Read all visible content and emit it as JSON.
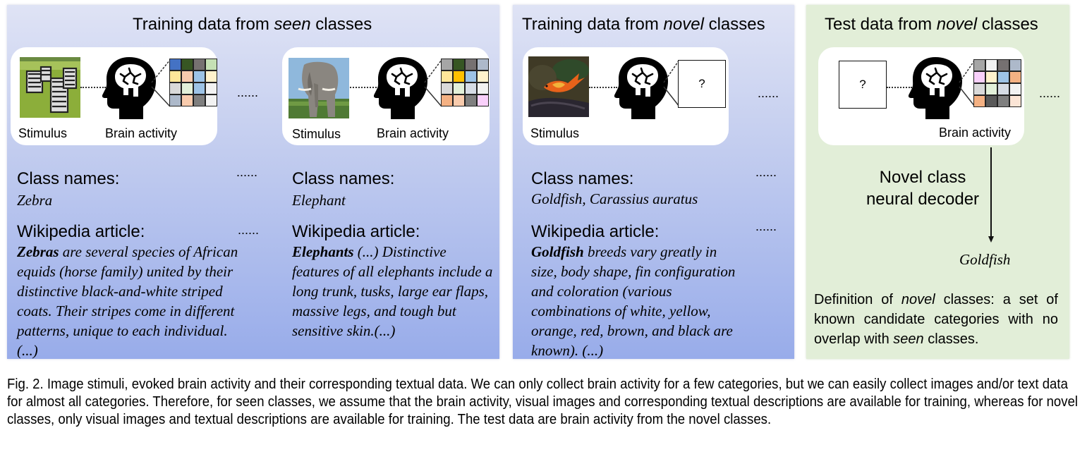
{
  "panels": {
    "seen": {
      "title_prefix": "Training data from ",
      "title_em": "seen",
      "title_suffix": " classes",
      "examples": [
        {
          "stimulus_label": "Stimulus",
          "stimulus_image": "zebra",
          "brain_label": "Brain activity",
          "grid_colors": [
            "#4472c4",
            "#375623",
            "#767171",
            "#c5e0b4",
            "#ffe699",
            "#f8cbad",
            "#9dc3e6",
            "#fff2cc",
            "#d9d9d9",
            "#e2f0d9",
            "#9dc3e6",
            "#f2f2f2",
            "#adb9ca",
            "#f8cbad",
            "#7f7f7f",
            "#f2f2f2"
          ],
          "class_names_heading": "Class names:",
          "class_name": "Zebra",
          "article_heading": "Wikipedia article:",
          "article_bold": "Zebras",
          "article_text": " are several species of African equids (horse family) united by their distinctive black-and-white striped coats. Their stripes come in different patterns, unique to each individual. (...)"
        },
        {
          "stimulus_label": "Stimulus",
          "stimulus_image": "elephant",
          "brain_label": "Brain activity",
          "grid_colors": [
            "#a6a6a6",
            "#375623",
            "#767171",
            "#adb9ca",
            "#ffe699",
            "#ffc000",
            "#9dc3e6",
            "#fff2cc",
            "#d9d9d9",
            "#e2f0d9",
            "#d6dce5",
            "#f2f2f2",
            "#f4b183",
            "#f8cbad",
            "#7f7f7f",
            "#f9d0fb"
          ],
          "class_names_heading": "Class names:",
          "class_name": "Elephant",
          "article_heading": "Wikipedia article:",
          "article_bold": "Elephants",
          "article_text": " (...) Distinctive features of all elephants include a long trunk, tusks, large ear flaps, massive legs, and tough but sensitive skin.(...)"
        }
      ],
      "ellipsis": "......"
    },
    "novel_train": {
      "title_prefix": "Training data from ",
      "title_em": "novel",
      "title_suffix": " classes",
      "example": {
        "stimulus_label": "Stimulus",
        "stimulus_image": "goldfish",
        "unknown_mark": "?",
        "class_names_heading": "Class names:",
        "class_name": "Goldfish, Carassius auratus",
        "article_heading": "Wikipedia article:",
        "article_bold": "Goldfish",
        "article_text": " breeds vary greatly in size, body shape, fin configuration and coloration (various combinations of white, yellow, orange, red, brown, and black are known). (...)"
      },
      "ellipsis": "......"
    },
    "test": {
      "title_prefix": "Test data from ",
      "title_em": "novel",
      "title_suffix": " classes",
      "unknown_mark": "?",
      "brain_label": "Brain activity",
      "grid_colors": [
        "#a6a6a6",
        "#f2f2f2",
        "#767171",
        "#adb9ca",
        "#f9d0fb",
        "#fff2cc",
        "#9dc3e6",
        "#f4b183",
        "#d9d9d9",
        "#e2f0d9",
        "#d6dce5",
        "#f2f2f2",
        "#f4b183",
        "#595959",
        "#7f7f7f",
        "#fbe5d6"
      ],
      "decoder_line1": "Novel class",
      "decoder_line2": "neural decoder",
      "prediction": "Goldfish",
      "definition_p1": "Definition of ",
      "definition_em1": "novel",
      "definition_p2": " classes: a set of known candidate categories with no overlap with ",
      "definition_em2": "seen",
      "definition_p3": " classes.",
      "ellipsis": "......"
    }
  },
  "colors": {
    "blue_panel_top": "#dfe3f5",
    "blue_panel_bottom": "#98acea",
    "green_panel": "#e2eed8"
  },
  "caption": "Fig. 2. Image stimuli, evoked brain activity and their corresponding textual data. We can only collect brain activity for a few categories, but we can easily collect images and/or text data for almost all categories. Therefore, for seen classes, we assume that the brain activity, visual images and corresponding textual descriptions are available for training, whereas for novel classes, only visual images and textual descriptions are available for training. The test data are brain activity from the novel classes."
}
